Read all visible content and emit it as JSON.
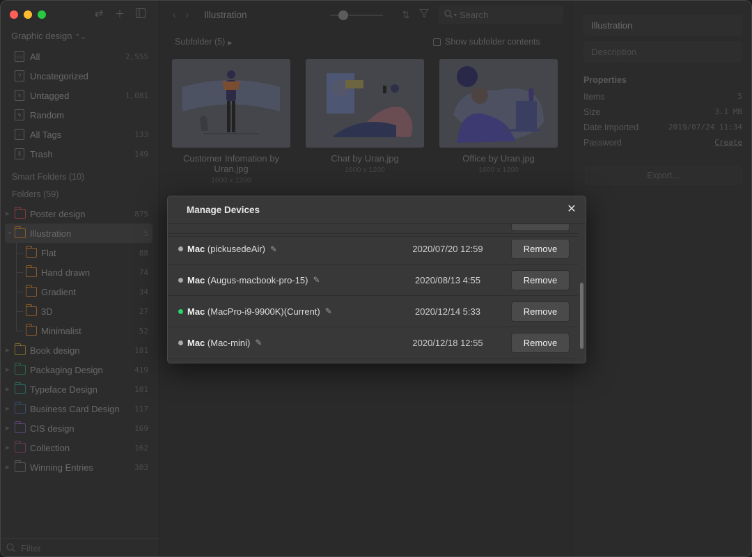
{
  "sidebar": {
    "library": "Graphic design",
    "nav": [
      {
        "icon": "archive-icon",
        "label": "All",
        "count": "2,555"
      },
      {
        "icon": "question-icon",
        "label": "Uncategorized",
        "count": ""
      },
      {
        "icon": "untagged-icon",
        "label": "Untagged",
        "count": "1,081"
      },
      {
        "icon": "lightbulb-icon",
        "label": "Random",
        "count": ""
      },
      {
        "icon": "tag-icon",
        "label": "All Tags",
        "count": "133"
      },
      {
        "icon": "trash-icon",
        "label": "Trash",
        "count": "149"
      }
    ],
    "smart_folders": "Smart Folders (10)",
    "folders_head": "Folders (59)",
    "folders": [
      {
        "label": "Poster design",
        "count": "875",
        "color": "#8a3a3f"
      },
      {
        "label": "Illustration",
        "count": "5",
        "color": "#8a5a2a",
        "expanded": true
      },
      {
        "label": "Book design",
        "count": "181",
        "color": "#7a6a2a"
      },
      {
        "label": "Packaging Design",
        "count": "419",
        "color": "#2a6a4a"
      },
      {
        "label": "Typeface Design",
        "count": "101",
        "color": "#2a6660"
      },
      {
        "label": "Business Card Design",
        "count": "117",
        "color": "#3a4f70"
      },
      {
        "label": "CIS design",
        "count": "169",
        "color": "#5a4470"
      },
      {
        "label": "Collection",
        "count": "162",
        "color": "#6a3a5a"
      },
      {
        "label": "Winning Entries",
        "count": "303",
        "color": "#555555"
      }
    ],
    "subfolders": [
      {
        "label": "Flat",
        "count": "88"
      },
      {
        "label": "Hand drawn",
        "count": "74"
      },
      {
        "label": "Gradient",
        "count": "34"
      },
      {
        "label": "3D",
        "count": "27"
      },
      {
        "label": "Minimalist",
        "count": "52"
      }
    ],
    "filter_placeholder": "Filter"
  },
  "toolbar": {
    "breadcrumb": "Illustration",
    "zoom_fraction": 0.25,
    "search_placeholder": "Search"
  },
  "main": {
    "subfolder_label": "Subfolder (5)",
    "show_subfolder_label": "Show subfolder contents",
    "items": [
      {
        "name": "Customer Infomation by Uran.jpg",
        "dims": "1600 x 1200"
      },
      {
        "name": "Chat by Uran.jpg",
        "dims": "1600 x 1200"
      },
      {
        "name": "Office by Uran.jpg",
        "dims": "1600 x 1200"
      }
    ]
  },
  "inspector": {
    "title": "Illustration",
    "description_placeholder": "Description",
    "properties_head": "Properties",
    "props": [
      {
        "label": "Items",
        "value": "5"
      },
      {
        "label": "Size",
        "value": "3.1 MB"
      },
      {
        "label": "Date Imported",
        "value": "2019/07/24 11:34"
      },
      {
        "label": "Password",
        "value": "Create"
      }
    ],
    "export_label": "Export..."
  },
  "modal": {
    "title": "Manage Devices",
    "remove_label": "Remove",
    "devices": [
      {
        "type": "Mac",
        "name": "(pickusedeAir)",
        "date": "2020/07/20 12:59",
        "status_color": "#aaaaaa"
      },
      {
        "type": "Mac",
        "name": "(Augus-macbook-pro-15)",
        "date": "2020/08/13 4:55",
        "status_color": "#aaaaaa"
      },
      {
        "type": "Mac",
        "name": "(MacPro-i9-9900K)(Current)",
        "date": "2020/12/14 5:33",
        "status_color": "#2bd46a"
      },
      {
        "type": "Mac",
        "name": "(Mac-mini)",
        "date": "2020/12/18 12:55",
        "status_color": "#aaaaaa"
      }
    ]
  }
}
